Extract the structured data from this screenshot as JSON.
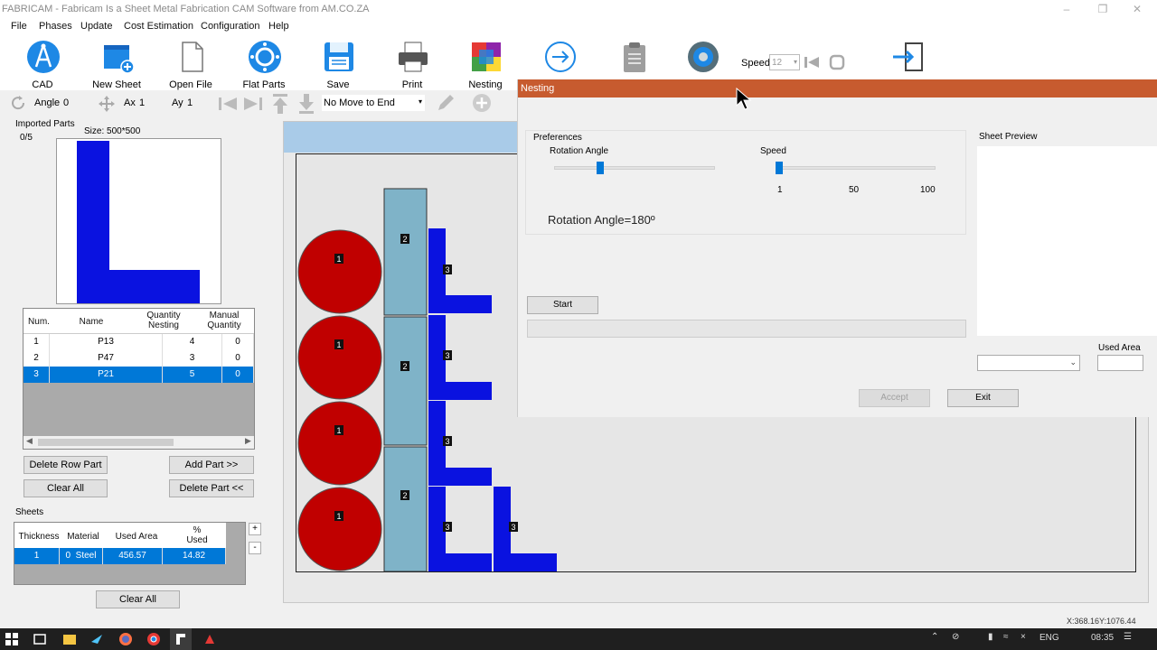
{
  "window": {
    "title": "FABRICAM - Fabricam Is a Sheet Metal Fabrication CAM Software from AM.CO.ZA",
    "min_icon": "minimize-icon",
    "max_icon": "restore-icon",
    "close_icon": "close-icon"
  },
  "menu": [
    "File",
    "Phases",
    "Update",
    "Cost Estimation",
    "Configuration",
    "Help"
  ],
  "toolbar": {
    "cad": "CAD",
    "new_sheet": "New Sheet",
    "open_file": "Open File",
    "flat_parts": "Flat Parts",
    "save": "Save",
    "print": "Print",
    "nesting": "Nesting",
    "speed_label": "Speed",
    "speed_value": "12"
  },
  "toolbar2": {
    "angle_label": "Angle",
    "angle_value": "0",
    "ax_label": "Ax",
    "ax_value": "1",
    "ay_label": "Ay",
    "ay_value": "1",
    "move_select": "No Move to End"
  },
  "imported": {
    "label": "Imported Parts",
    "count": "0/5",
    "size": "Size: 500*500"
  },
  "parts_table": {
    "headers": [
      "Num.",
      "Name",
      "Quantity Nesting",
      "Manual Quantity"
    ],
    "rows": [
      {
        "num": "1",
        "name": "P13",
        "qty": "4",
        "manual": "0"
      },
      {
        "num": "2",
        "name": "P47",
        "qty": "3",
        "manual": "0"
      },
      {
        "num": "3",
        "name": "P21",
        "qty": "5",
        "manual": "0"
      }
    ]
  },
  "buttons": {
    "delete_row": "Delete Row Part",
    "add_part": "Add Part >>",
    "clear_all": "Clear All",
    "delete_part": "Delete Part <<",
    "clear_all_sheets": "Clear All"
  },
  "sheets": {
    "label": "Sheets",
    "headers": [
      "Thickness",
      "Material",
      "Used Area",
      "% Used"
    ],
    "rows": [
      {
        "thickness": "1",
        "mat_idx": "0",
        "material": "Steel",
        "used_area": "456.57",
        "pct": "14.82"
      }
    ],
    "plus": "+",
    "minus": "-"
  },
  "dialog": {
    "title": "Nesting",
    "preferences": "Preferences",
    "rotation_angle": "Rotation Angle",
    "rotation_fraction": 0.28,
    "speed": "Speed",
    "speed_fraction": 0.0,
    "speed_ticks": [
      "1",
      "50",
      "100"
    ],
    "rotation_text": "Rotation Angle=180º",
    "start": "Start",
    "sheet_preview": "Sheet Preview",
    "used_area": "Used Area",
    "accept": "Accept",
    "exit": "Exit"
  },
  "canvas": {
    "labels_circle": [
      "1",
      "1",
      "1",
      "1"
    ],
    "labels_rect": [
      "2",
      "2",
      "2"
    ],
    "labels_l": [
      "3",
      "3",
      "3",
      "3",
      "3"
    ]
  },
  "status": {
    "coords": "X:368.16Y:1076.44"
  },
  "taskbar": {
    "lang": "ENG",
    "time": "08:35"
  },
  "colors": {
    "accent": "#0078d7",
    "dialog_title": "#c75b2f",
    "part_red": "#c00000",
    "part_teal": "#7fb3c8",
    "part_blue": "#0a12e0"
  }
}
